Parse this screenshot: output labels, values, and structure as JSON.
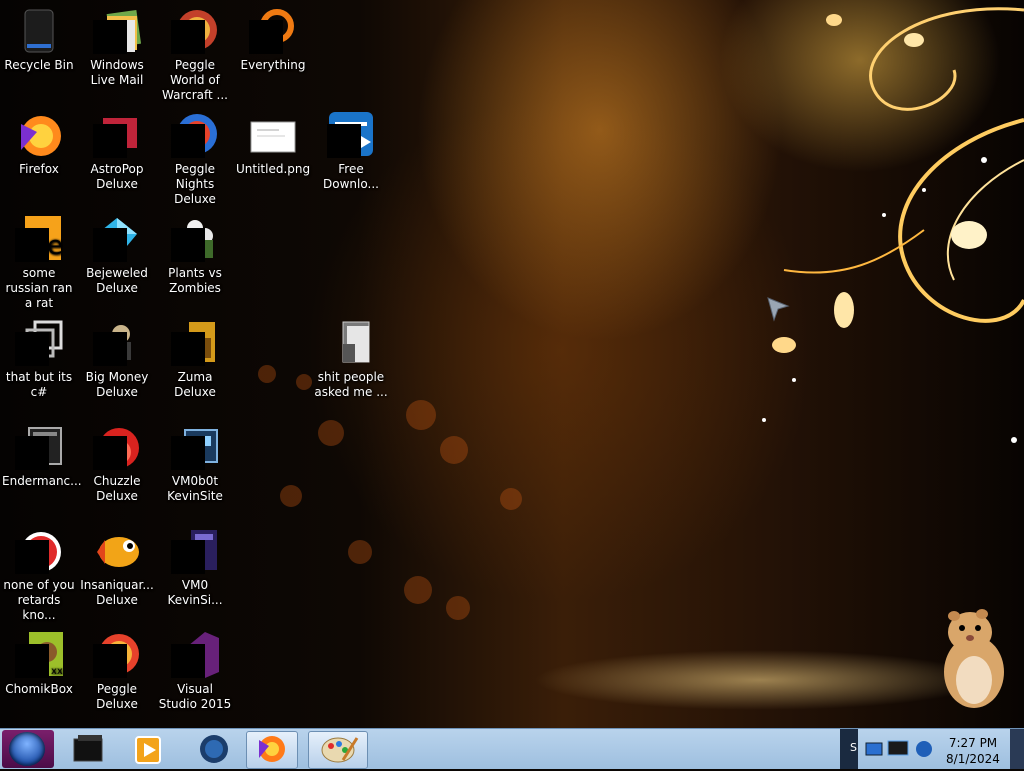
{
  "desktop": {
    "icons": [
      {
        "label": "Recycle Bin",
        "glyph": "recycle-bin-icon"
      },
      {
        "label": "Windows Live Mail",
        "glyph": "windows-live-mail-icon"
      },
      {
        "label": "Peggle World of Warcraft ...",
        "glyph": "peggle-wow-icon"
      },
      {
        "label": "Everything",
        "glyph": "everything-icon"
      },
      {
        "label": "Firefox",
        "glyph": "firefox-icon"
      },
      {
        "label": "AstroPop Deluxe",
        "glyph": "astropop-icon"
      },
      {
        "label": "Peggle Nights Deluxe",
        "glyph": "peggle-nights-icon"
      },
      {
        "label": "Untitled.png",
        "glyph": "png-file-icon"
      },
      {
        "label": "Free Downlo...",
        "glyph": "free-download-icon"
      },
      {
        "label": "some russian ran a rat",
        "glyph": "shortcut-icon"
      },
      {
        "label": "Bejeweled Deluxe",
        "glyph": "bejeweled-icon"
      },
      {
        "label": "Plants vs Zombies",
        "glyph": "plants-vs-zombies-icon"
      },
      {
        "label": "that but its c#",
        "glyph": "shortcut-icon"
      },
      {
        "label": "Big Money Deluxe",
        "glyph": "big-money-icon"
      },
      {
        "label": "Zuma Deluxe",
        "glyph": "zuma-icon"
      },
      {
        "label": "shit people asked me ...",
        "glyph": "folder-icon"
      },
      {
        "label": "Endermanc...",
        "glyph": "app-window-icon"
      },
      {
        "label": "Chuzzle Deluxe",
        "glyph": "chuzzle-icon"
      },
      {
        "label": "VM0b0t KevinSite",
        "glyph": "vm-folder-icon"
      },
      {
        "label": "none of you retards kno...",
        "glyph": "shortcut-icon"
      },
      {
        "label": "Insaniquar... Deluxe",
        "glyph": "insaniquarium-icon"
      },
      {
        "label": "VM0 KevinSi...",
        "glyph": "document-icon"
      },
      {
        "label": "ChomikBox",
        "glyph": "chomikbox-icon"
      },
      {
        "label": "Peggle Deluxe",
        "glyph": "peggle-icon"
      },
      {
        "label": "Visual Studio 2015",
        "glyph": "visual-studio-icon"
      }
    ]
  },
  "taskbar": {
    "start_glyph": "windows-orb-icon",
    "pinned": [
      {
        "glyph": "dark-app-icon"
      },
      {
        "glyph": "media-player-icon"
      },
      {
        "glyph": "globe-app-icon"
      },
      {
        "glyph": "firefox-icon"
      },
      {
        "glyph": "paint-icon"
      }
    ],
    "tray_label": "S",
    "clock_time": "7:27 PM",
    "clock_date": "8/1/2024"
  }
}
